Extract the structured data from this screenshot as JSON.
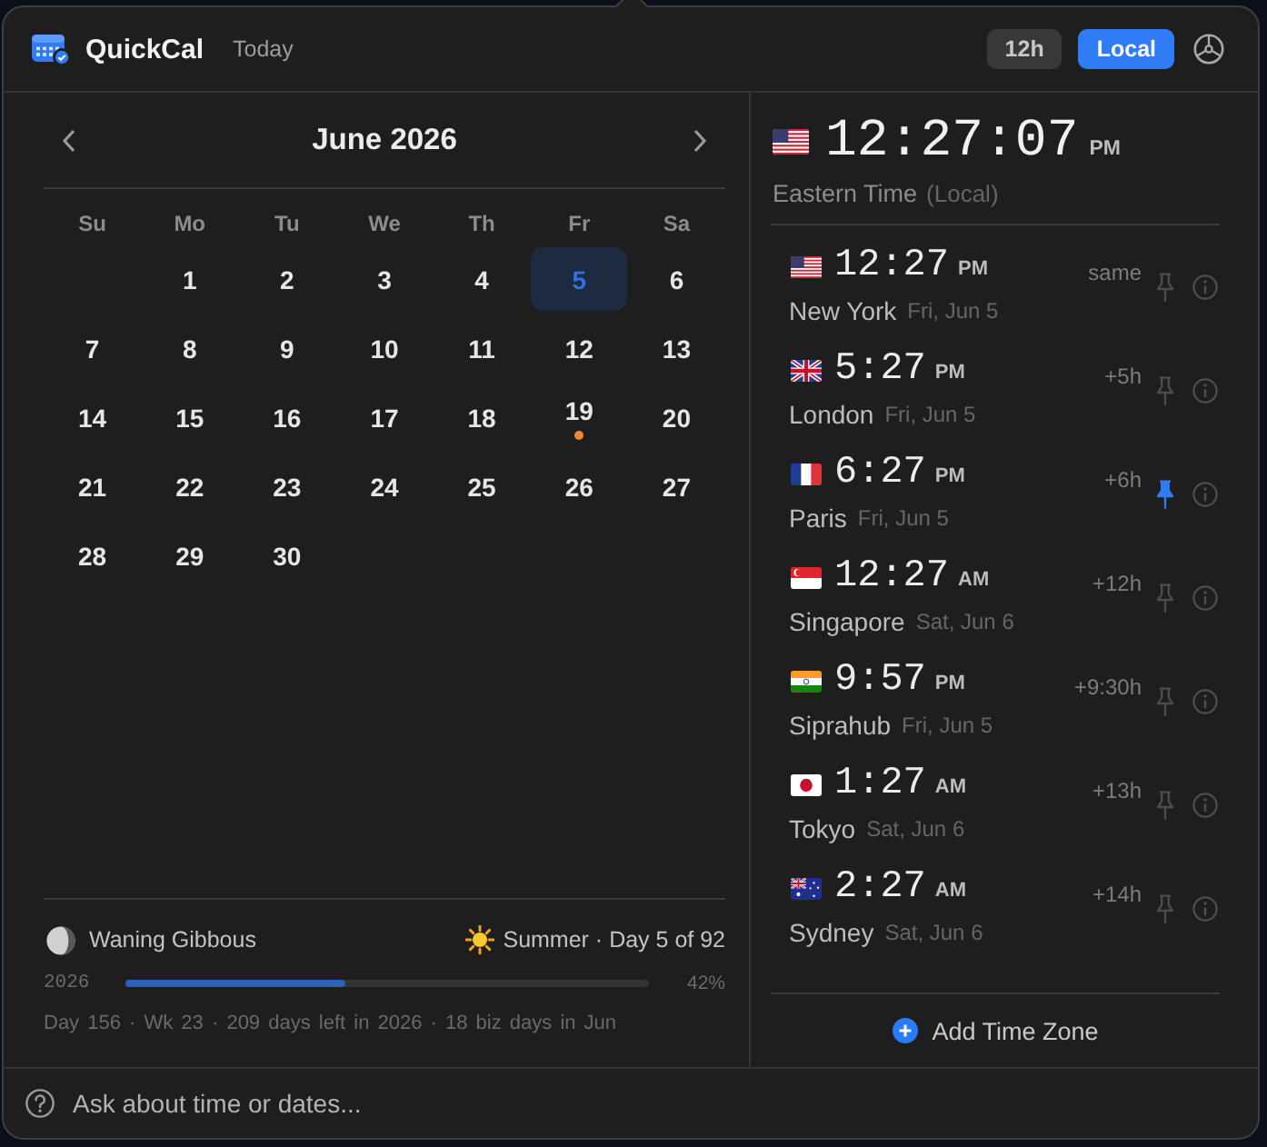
{
  "header": {
    "app_title": "QuickCal",
    "today_button": "Today",
    "toggles": [
      {
        "label": "12h",
        "selected": false
      },
      {
        "label": "Local",
        "selected": true
      }
    ]
  },
  "calendar": {
    "month": "June 2026",
    "weekdays": [
      "Su",
      "Mo",
      "Tu",
      "We",
      "Th",
      "Fr",
      "Sa"
    ],
    "weeks": [
      [
        {
          "day": "1",
          "selected": false,
          "event": false
        },
        {
          "day": "2",
          "selected": false,
          "event": false
        },
        {
          "day": "3",
          "selected": false,
          "event": false
        },
        {
          "day": "4",
          "selected": false,
          "event": false
        },
        {
          "day": "5",
          "selected": true,
          "event": false
        },
        {
          "day": "6",
          "selected": false,
          "event": false
        }
      ],
      [
        {
          "day": "7",
          "selected": false,
          "event": false
        },
        {
          "day": "8",
          "selected": false,
          "event": false
        },
        {
          "day": "9",
          "selected": false,
          "event": false
        },
        {
          "day": "10",
          "selected": false,
          "event": false
        },
        {
          "day": "11",
          "selected": false,
          "event": false
        },
        {
          "day": "12",
          "selected": false,
          "event": false
        },
        {
          "day": "13",
          "selected": false,
          "event": false
        }
      ],
      [
        {
          "day": "14",
          "selected": false,
          "event": false
        },
        {
          "day": "15",
          "selected": false,
          "event": false
        },
        {
          "day": "16",
          "selected": false,
          "event": false
        },
        {
          "day": "17",
          "selected": false,
          "event": false
        },
        {
          "day": "18",
          "selected": false,
          "event": false
        },
        {
          "day": "19",
          "selected": false,
          "event": true
        },
        {
          "day": "20",
          "selected": false,
          "event": false
        }
      ],
      [
        {
          "day": "21",
          "selected": false,
          "event": false
        },
        {
          "day": "22",
          "selected": false,
          "event": false
        },
        {
          "day": "23",
          "selected": false,
          "event": false
        },
        {
          "day": "24",
          "selected": false,
          "event": false
        },
        {
          "day": "25",
          "selected": false,
          "event": false
        },
        {
          "day": "26",
          "selected": false,
          "event": false
        },
        {
          "day": "27",
          "selected": false,
          "event": false
        }
      ],
      [
        {
          "day": "28",
          "selected": false,
          "event": false
        },
        {
          "day": "29",
          "selected": false,
          "event": false
        },
        {
          "day": "30",
          "selected": false,
          "event": false
        }
      ]
    ]
  },
  "summary": {
    "moon_phase": "Waning Gibbous",
    "season": "Summer · Day 5 of 92",
    "year_progress": {
      "label": "2026",
      "level": 0.42,
      "reading": "42%"
    },
    "stats": "Day 156 · Wk 23 · 209 days left in 2026 · 18 biz days in Jun"
  },
  "ask": {
    "placeholder": "Ask about time or dates..."
  },
  "clock": {
    "kind": "us",
    "time": "12:27:07",
    "period": "PM",
    "zone": "Eastern Time",
    "note": "(Local)"
  },
  "zones": [
    {
      "kind": "us",
      "time": "12:27",
      "period": "PM",
      "city": "New York",
      "date": "Fri, Jun 5",
      "offset": "same",
      "pinned": false
    },
    {
      "kind": "gb",
      "time": "5:27",
      "period": "PM",
      "city": "London",
      "date": "Fri, Jun 5",
      "offset": "+5h",
      "pinned": false
    },
    {
      "kind": "fr",
      "time": "6:27",
      "period": "PM",
      "city": "Paris",
      "date": "Fri, Jun 5",
      "offset": "+6h",
      "pinned": true
    },
    {
      "kind": "sg",
      "time": "12:27",
      "period": "AM",
      "city": "Singapore",
      "date": "Sat, Jun 6",
      "offset": "+12h",
      "pinned": false
    },
    {
      "kind": "in",
      "time": "9:57",
      "period": "PM",
      "city": "Siprahub",
      "date": "Fri, Jun 5",
      "offset": "+9:30h",
      "pinned": false
    },
    {
      "kind": "jp",
      "time": "1:27",
      "period": "AM",
      "city": "Tokyo",
      "date": "Sat, Jun 6",
      "offset": "+13h",
      "pinned": false
    },
    {
      "kind": "au",
      "time": "2:27",
      "period": "AM",
      "city": "Sydney",
      "date": "Sat, Jun 6",
      "offset": "+14h",
      "pinned": false
    }
  ],
  "add_button": "Add Time Zone"
}
